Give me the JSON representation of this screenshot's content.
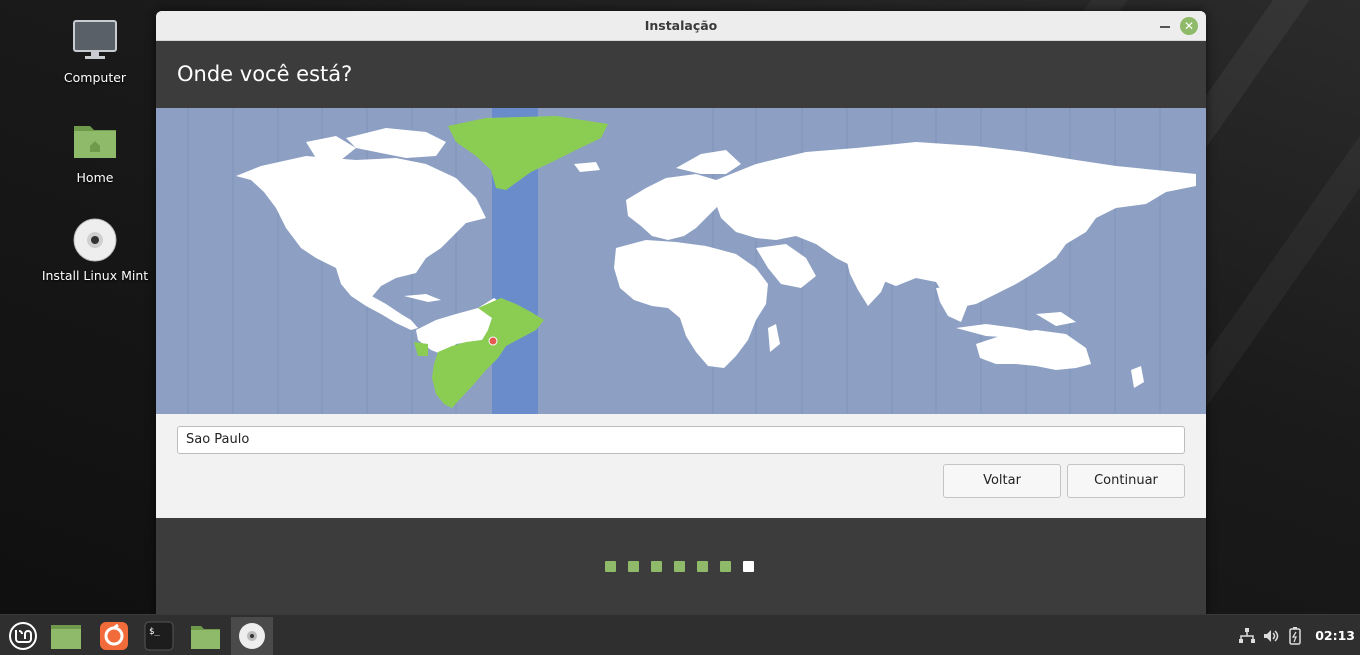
{
  "desktop": {
    "icons": [
      {
        "label": "Computer"
      },
      {
        "label": "Home"
      },
      {
        "label": "Install Linux Mint"
      }
    ]
  },
  "window": {
    "title": "Instalação",
    "header": "Onde você está?",
    "location_value": "Sao Paulo",
    "back_label": "Voltar",
    "continue_label": "Continuar",
    "progress": {
      "total_steps": 7,
      "current_step": 7
    }
  },
  "taskbar": {
    "clock": "02:13"
  },
  "colors": {
    "accent": "#8fba69",
    "ocean": "#8da0c3",
    "timezone_band": "#6b8ccb",
    "land": "#ffffff",
    "selected_zone": "#8bcd53",
    "header_bg": "#3c3c3c"
  }
}
